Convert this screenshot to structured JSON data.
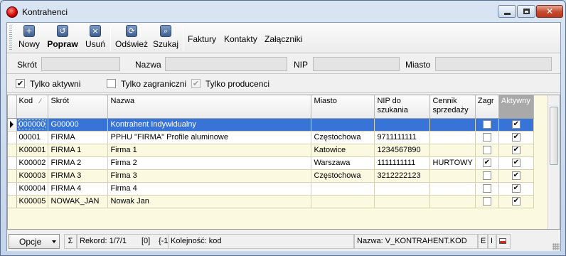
{
  "window": {
    "title": "Kontrahenci"
  },
  "toolbar": {
    "buttons": [
      {
        "label": "Nowy",
        "icon": "plus-icon"
      },
      {
        "label": "Popraw",
        "icon": "edit-icon"
      },
      {
        "label": "Usuń",
        "icon": "delete-icon"
      },
      {
        "label": "Odśwież",
        "icon": "refresh-icon"
      },
      {
        "label": "Szukaj",
        "icon": "search-icon"
      }
    ],
    "links": [
      "Faktury",
      "Kontakty",
      "Załączniki"
    ]
  },
  "search": {
    "skrot_label": "Skrót",
    "nazwa_label": "Nazwa",
    "nip_label": "NIP",
    "miasto_label": "Miasto"
  },
  "filters": {
    "aktywni": {
      "label": "Tylko aktywni",
      "checked": true
    },
    "zagraniczni": {
      "label": "Tylko zagraniczni",
      "checked": false
    },
    "producenci": {
      "label": "Tylko producenci",
      "checked": true,
      "disabled": true
    }
  },
  "grid": {
    "columns": {
      "kod": "Kod",
      "skrot": "Skrót",
      "nazwa": "Nazwa",
      "miasto": "Miasto",
      "nip": "NIP do szukania",
      "cennik": "Cennik sprzedaży",
      "zagr": "Zagr",
      "aktywny": "Aktywny"
    },
    "rows": [
      {
        "kod": "000000",
        "skrot": "G00000",
        "nazwa": "Kontrahent Indywidualny",
        "miasto": "",
        "nip": "",
        "cennik": "",
        "zagr": false,
        "aktywny": true
      },
      {
        "kod": "00001",
        "skrot": "FIRMA",
        "nazwa": "PPHU \"FIRMA\" Profile aluminowe",
        "miasto": "Częstochowa",
        "nip": "9711111111",
        "cennik": "",
        "zagr": false,
        "aktywny": true
      },
      {
        "kod": "K00001",
        "skrot": "FIRMA 1",
        "nazwa": "Firma 1",
        "miasto": "Katowice",
        "nip": "1234567890",
        "cennik": "",
        "zagr": false,
        "aktywny": true
      },
      {
        "kod": "K00002",
        "skrot": "FIRMA 2",
        "nazwa": "Firma 2",
        "miasto": "Warszawa",
        "nip": "1111111111",
        "cennik": "HURTOWY",
        "zagr": true,
        "aktywny": true
      },
      {
        "kod": "K00003",
        "skrot": "FIRMA 3",
        "nazwa": "Firma 3",
        "miasto": "Częstochowa",
        "nip": "3212222123",
        "cennik": "",
        "zagr": false,
        "aktywny": true
      },
      {
        "kod": "K00004",
        "skrot": "FIRMA 4",
        "nazwa": "Firma 4",
        "miasto": "",
        "nip": "",
        "cennik": "",
        "zagr": false,
        "aktywny": true
      },
      {
        "kod": "K00005",
        "skrot": "NOWAK_JAN",
        "nazwa": "Nowak Jan",
        "miasto": "",
        "nip": "",
        "cennik": "",
        "zagr": false,
        "aktywny": true
      }
    ]
  },
  "status": {
    "opcje": "Opcje",
    "sigma": "Σ",
    "rekord": "Rekord: 1/7/1",
    "zero": "[0]",
    "minus_one": "{-1}",
    "kolejnosc": "Kolejność: kod",
    "nazwa": "Nazwa: V_KONTRAHENT.KOD",
    "e": "E",
    "i": "I"
  }
}
